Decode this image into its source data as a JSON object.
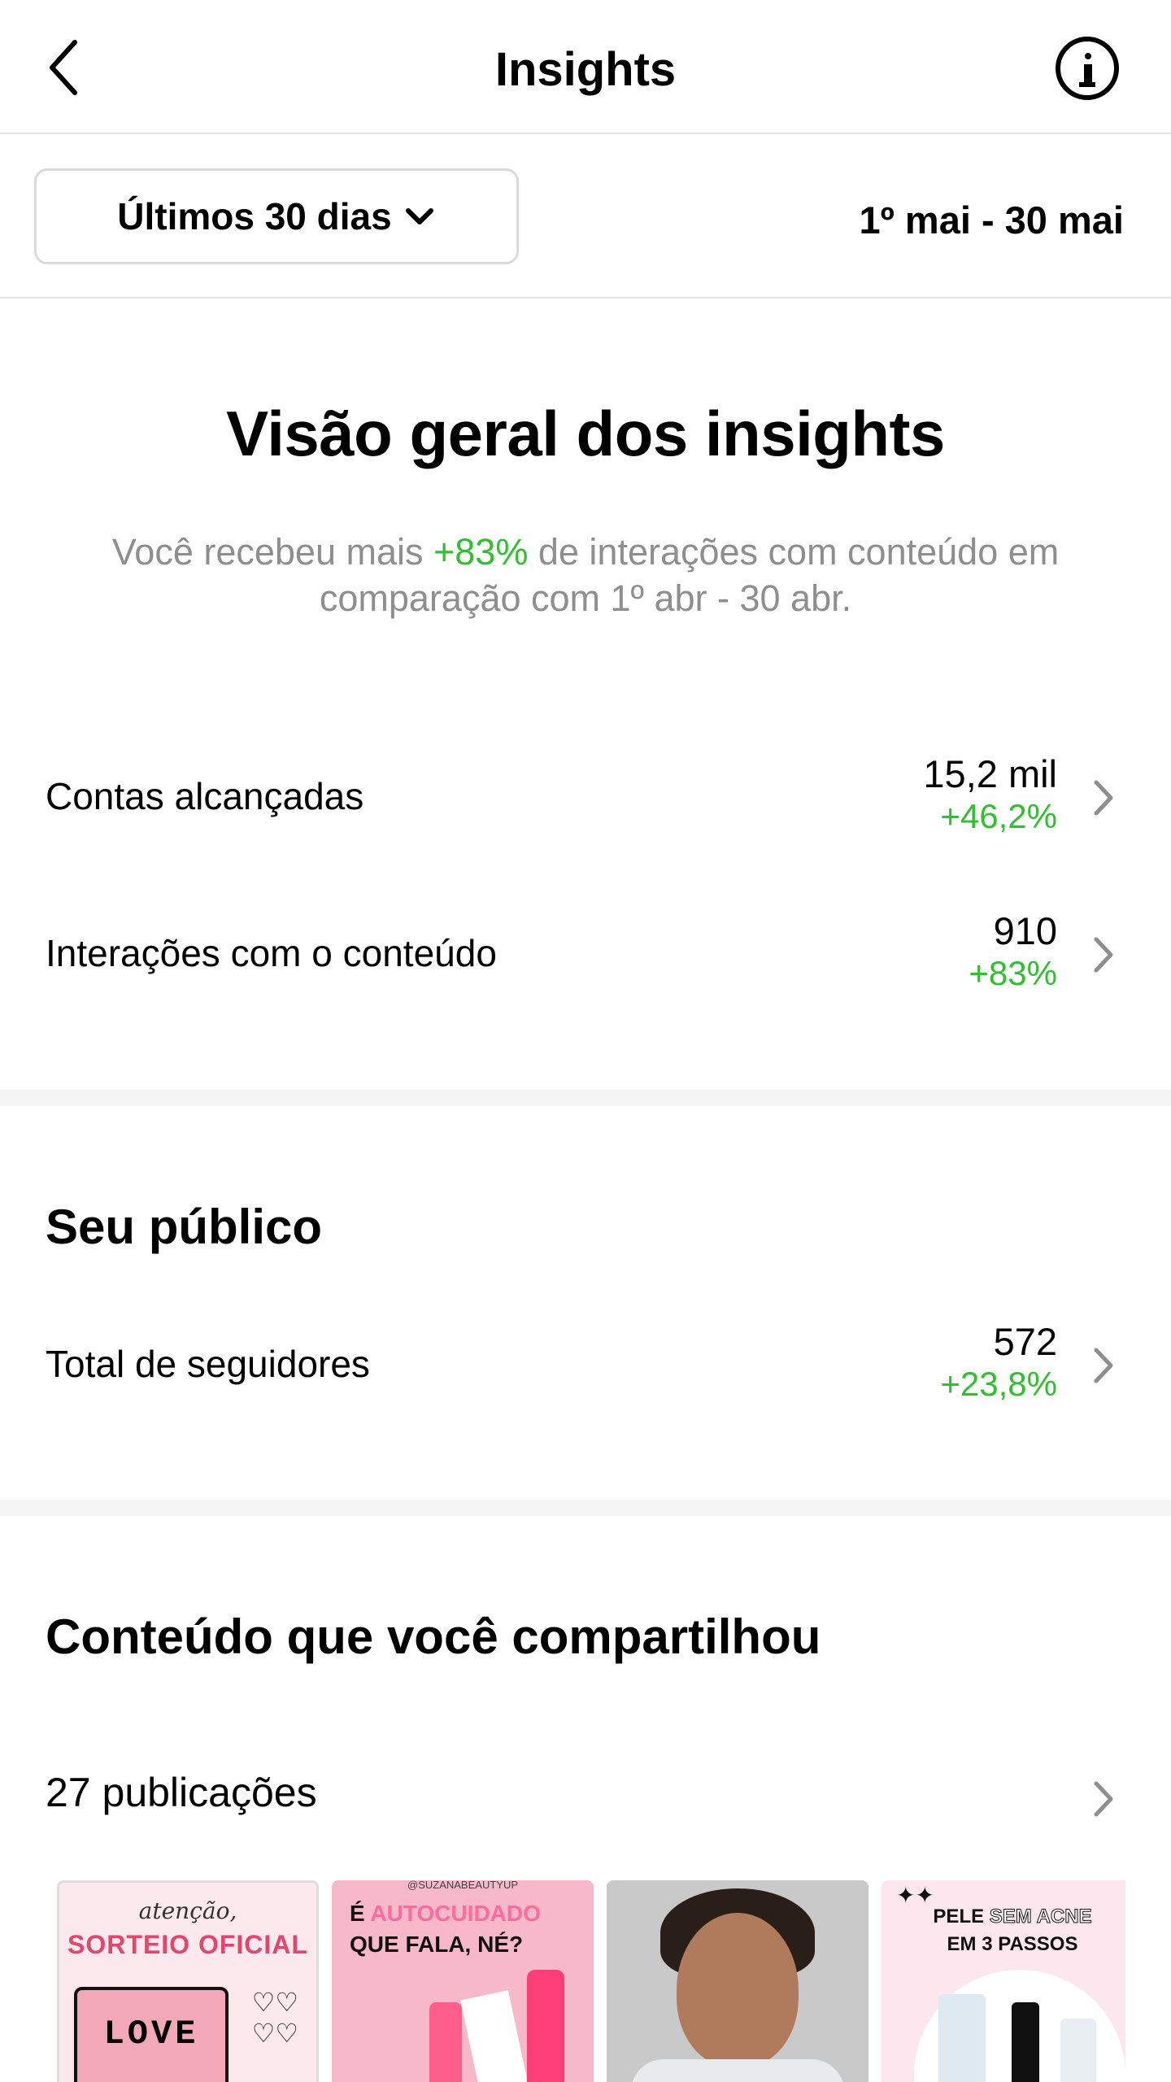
{
  "header": {
    "title": "Insights",
    "back_icon": "chevron-left-icon",
    "info_icon": "info-icon"
  },
  "filter": {
    "period_label": "Últimos 30 dias",
    "dropdown_icon": "chevron-down-icon",
    "date_range": "1º mai - 30 mai"
  },
  "overview": {
    "title": "Visão geral dos insights",
    "sub_before": "Você recebeu mais ",
    "sub_pct": "+83%",
    "sub_after": " de interações com conteúdo em comparação com 1º abr - 30 abr."
  },
  "metrics": [
    {
      "label": "Contas alcançadas",
      "value": "15,2 mil",
      "change": "+46,2%"
    },
    {
      "label": "Interações com o conteúdo",
      "value": "910",
      "change": "+83%"
    }
  ],
  "audience": {
    "title": "Seu público",
    "metric": {
      "label": "Total de seguidores",
      "value": "572",
      "change": "+23,8%"
    }
  },
  "content": {
    "title": "Conteúdo que você compartilhou",
    "posts_label": "27 publicações",
    "thumbnails": [
      {
        "small_text": "atenção,",
        "big_text": "SORTEIO OFICIAL",
        "bag_text": "LOVE"
      },
      {
        "handle": "@SUZANABEAUTYUP",
        "line1_a": "É ",
        "line1_b": "AUTOCUIDADO",
        "line2": "QUE FALA, NÉ?"
      },
      {},
      {
        "line1": "PELE ",
        "line1_soft": "SEM ACNE",
        "line2": "EM 3 PASSOS"
      }
    ]
  },
  "colors": {
    "positive": "#2fbf2f",
    "muted_text": "#8e8e8e",
    "divider": "#e3e3e3",
    "section_gap": "#f5f5f5"
  }
}
